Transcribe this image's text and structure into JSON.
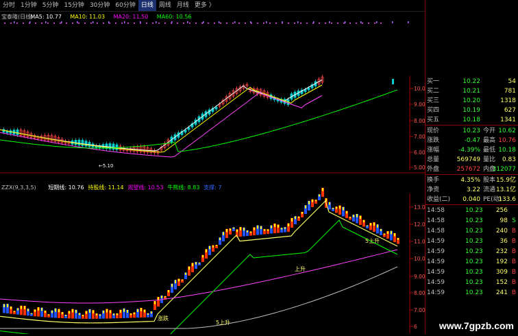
{
  "toolbar": {
    "tabs": [
      "分时",
      "1分钟",
      "5分钟",
      "15分钟",
      "30分钟",
      "60分钟",
      "日线",
      "周线",
      "月线",
      "更多 〉"
    ],
    "active": "日线"
  },
  "main_chart": {
    "legend": [
      {
        "text": "宝泰隆(日线)",
        "color": "#c0c0c0"
      },
      {
        "text": "MA5: 10.77",
        "color": "#ffffff"
      },
      {
        "text": "MA10: 11.03",
        "color": "#ffff00"
      },
      {
        "text": "MA20: 11.50",
        "color": "#ff00ff"
      },
      {
        "text": "MA60: 10.56",
        "color": "#00ff00"
      }
    ],
    "axis_ticks": [
      "10.00",
      "9.00",
      "8.00",
      "7.00",
      "6.00",
      "5.00"
    ],
    "low_annotation": "5.10"
  },
  "indicator_chart": {
    "legend": [
      {
        "text": "ZZX(9,3,3,5)",
        "color": "#c0c0c0"
      },
      {
        "text": "短期线: 10.76",
        "color": "#ffffff"
      },
      {
        "text": "持股线: 11.14",
        "color": "#ffff00"
      },
      {
        "text": "观望线: 10.53",
        "color": "#ff00ff"
      },
      {
        "text": "牛熊线: 8.83",
        "color": "#00ff00"
      },
      {
        "text": "支撑: 7",
        "color": "#3366ff"
      }
    ],
    "axis_ticks": [
      "13.00",
      "12.00",
      "11.00",
      "10.00",
      "9.00",
      "8.00",
      "7.00",
      "6"
    ],
    "annotations": [
      "5上升",
      "上升",
      "5上升",
      "涨跌"
    ]
  },
  "quote": {
    "bids": [
      {
        "label": "买一",
        "price": "10.22",
        "vol": "54"
      },
      {
        "label": "买二",
        "price": "10.21",
        "vol": "781"
      },
      {
        "label": "买三",
        "price": "10.20",
        "vol": "1318"
      },
      {
        "label": "买四",
        "price": "10.19",
        "vol": "627"
      },
      {
        "label": "买五",
        "price": "10.18",
        "vol": "1341"
      }
    ],
    "stats": [
      {
        "l1": "现价",
        "v1": "10.23",
        "c1": "#33ff33",
        "l2": "今开",
        "v2": "10.62",
        "c2": "#33ff33"
      },
      {
        "l1": "涨跌",
        "v1": "-0.47",
        "c1": "#33ff33",
        "l2": "最高",
        "v2": "10.76",
        "c2": "#ff4444"
      },
      {
        "l1": "涨幅",
        "v1": "-4.39%",
        "c1": "#33ff33",
        "l2": "最低",
        "v2": "10.18",
        "c2": "#33ff33"
      },
      {
        "l1": "总量",
        "v1": "569749",
        "c1": "#ffff66",
        "l2": "量比",
        "v2": "0.83",
        "c2": "#ffff66"
      },
      {
        "l1": "外盘",
        "v1": "257672",
        "c1": "#ff4444",
        "l2": "内盘",
        "v2": "312077",
        "c2": "#33ff33"
      }
    ],
    "extra": [
      {
        "l1": "换手",
        "v1": "4.35%",
        "l2": "股本",
        "v2": "15.9亿"
      },
      {
        "l1": "净资",
        "v1": "3.22",
        "l2": "流通",
        "v2": "13.1亿"
      },
      {
        "l1": "收益(二)",
        "v1": "0.040",
        "l2": "PE(动)",
        "v2": "133.6"
      }
    ],
    "ticks": [
      {
        "time": "14:58",
        "price": "10.23",
        "vol": "256",
        "bs": ""
      },
      {
        "time": "14:58",
        "price": "10.23",
        "vol": "98",
        "bs": "S"
      },
      {
        "time": "14:58",
        "price": "10.23",
        "vol": "240",
        "bs": "B"
      },
      {
        "time": "14:59",
        "price": "10.23",
        "vol": "36",
        "bs": "B"
      },
      {
        "time": "14:59",
        "price": "10.23",
        "vol": "232",
        "bs": "B"
      },
      {
        "time": "14:59",
        "price": "10.23",
        "vol": "192",
        "bs": "B"
      },
      {
        "time": "14:59",
        "price": "10.23",
        "vol": "309",
        "bs": "B"
      },
      {
        "time": "14:59",
        "price": "10.23",
        "vol": "152",
        "bs": "B"
      },
      {
        "time": "14:59",
        "price": "10.23",
        "vol": "241",
        "bs": "B"
      }
    ]
  },
  "watermark": "www.7gpzb.com"
}
